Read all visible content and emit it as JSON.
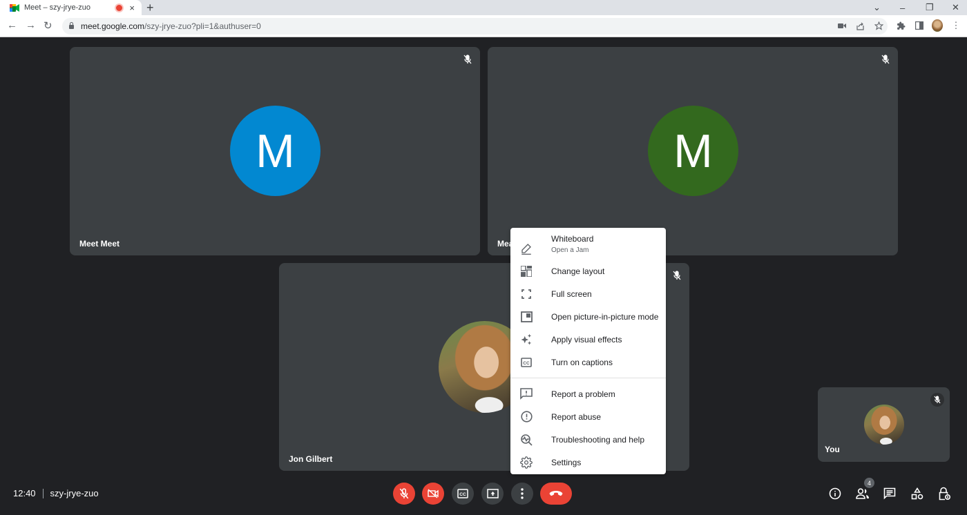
{
  "browser": {
    "tab_title": "Meet – szy-jrye-zuo",
    "tab_close": "×",
    "new_tab": "+",
    "url_host": "meet.google.com",
    "url_path": "/szy-jrye-zuo?pli=1&authuser=0",
    "window_controls": {
      "tab_search": "⌄",
      "minimize": "–",
      "restore": "❐",
      "close": "✕"
    },
    "nav": {
      "back": "←",
      "forward": "→",
      "reload": "↻"
    },
    "menu_dots": "⋮"
  },
  "colors": {
    "avatar_1": "#0288d1",
    "avatar_2": "#33691e",
    "danger": "#ea4335",
    "tile_bg": "#3c4043",
    "stage_bg": "#202124"
  },
  "participants": [
    {
      "name": "Meet Meet",
      "avatar_letter": "M",
      "avatar_type": "letter",
      "muted": true
    },
    {
      "name": "Meet Meet",
      "name_visible": "Mea",
      "avatar_letter": "M",
      "avatar_type": "letter",
      "muted": true
    },
    {
      "name": "Jon Gilbert",
      "avatar_type": "photo",
      "muted": true
    },
    {
      "name": "You",
      "avatar_type": "photo",
      "muted": true
    }
  ],
  "menu": {
    "items": [
      {
        "label": "Whiteboard",
        "sublabel": "Open a Jam",
        "icon": "pencil-icon"
      },
      {
        "label": "Change layout",
        "icon": "layout-icon"
      },
      {
        "label": "Full screen",
        "icon": "fullscreen-icon"
      },
      {
        "label": "Open picture-in-picture mode",
        "icon": "pip-icon"
      },
      {
        "label": "Apply visual effects",
        "icon": "sparkle-icon"
      },
      {
        "label": "Turn on captions",
        "icon": "captions-icon"
      },
      {
        "label": "Report a problem",
        "icon": "feedback-icon"
      },
      {
        "label": "Report abuse",
        "icon": "alert-circle-icon"
      },
      {
        "label": "Troubleshooting and help",
        "icon": "troubleshoot-icon"
      },
      {
        "label": "Settings",
        "icon": "gear-icon"
      }
    ]
  },
  "bottom_bar": {
    "time": "12:40",
    "meeting_code": "szy-jrye-zuo",
    "controls": [
      {
        "name": "microphone",
        "state": "off"
      },
      {
        "name": "camera",
        "state": "off"
      },
      {
        "name": "captions",
        "state": "off"
      },
      {
        "name": "present-now"
      },
      {
        "name": "more-options",
        "state": "open"
      },
      {
        "name": "leave-call"
      }
    ],
    "participants_count": "4"
  }
}
